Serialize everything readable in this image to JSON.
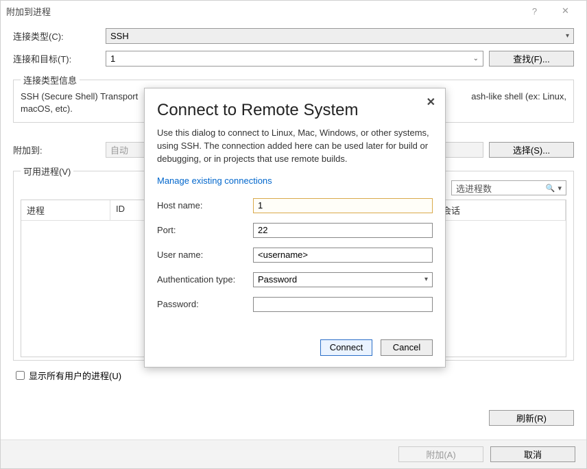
{
  "window": {
    "title": "附加到进程",
    "help_glyph": "?",
    "close_glyph": "✕"
  },
  "form": {
    "connection_type_label": "连接类型(C):",
    "connection_type_value": "SSH",
    "connection_target_label": "连接和目标(T):",
    "connection_target_value": "1",
    "find_button": "查找(F)...",
    "type_info_legend": "连接类型信息",
    "type_info_text_left": "SSH (Secure Shell) Transport",
    "type_info_text_right": "ash-like shell (ex: Linux,",
    "type_info_text_line2": "macOS, etc).",
    "attach_to_label": "附加到:",
    "attach_to_value": "自动",
    "select_button": "选择(S)...",
    "available_legend": "可用进程(V)",
    "filter_placeholder": "选进程数",
    "search_glyph": "🔍",
    "columns": {
      "c1": "进程",
      "c2": "ID",
      "c3": "会话"
    },
    "show_all_label": "显示所有用户的进程(U)",
    "refresh_button": "刷新(R)",
    "attach_button": "附加(A)",
    "cancel_button": "取消"
  },
  "modal": {
    "close_glyph": "✕",
    "title": "Connect to Remote System",
    "description": "Use this dialog to connect to Linux, Mac, Windows, or other systems, using SSH. The connection added here can be used later for build or debugging, or in projects that use remote builds.",
    "manage_link": "Manage existing connections",
    "hostname_label": "Host name:",
    "hostname_value": "1",
    "port_label": "Port:",
    "port_value": "22",
    "username_label": "User name:",
    "username_value": "<username>",
    "auth_label": "Authentication type:",
    "auth_value": "Password",
    "password_label": "Password:",
    "password_value": "",
    "connect_button": "Connect",
    "cancel_button": "Cancel"
  }
}
